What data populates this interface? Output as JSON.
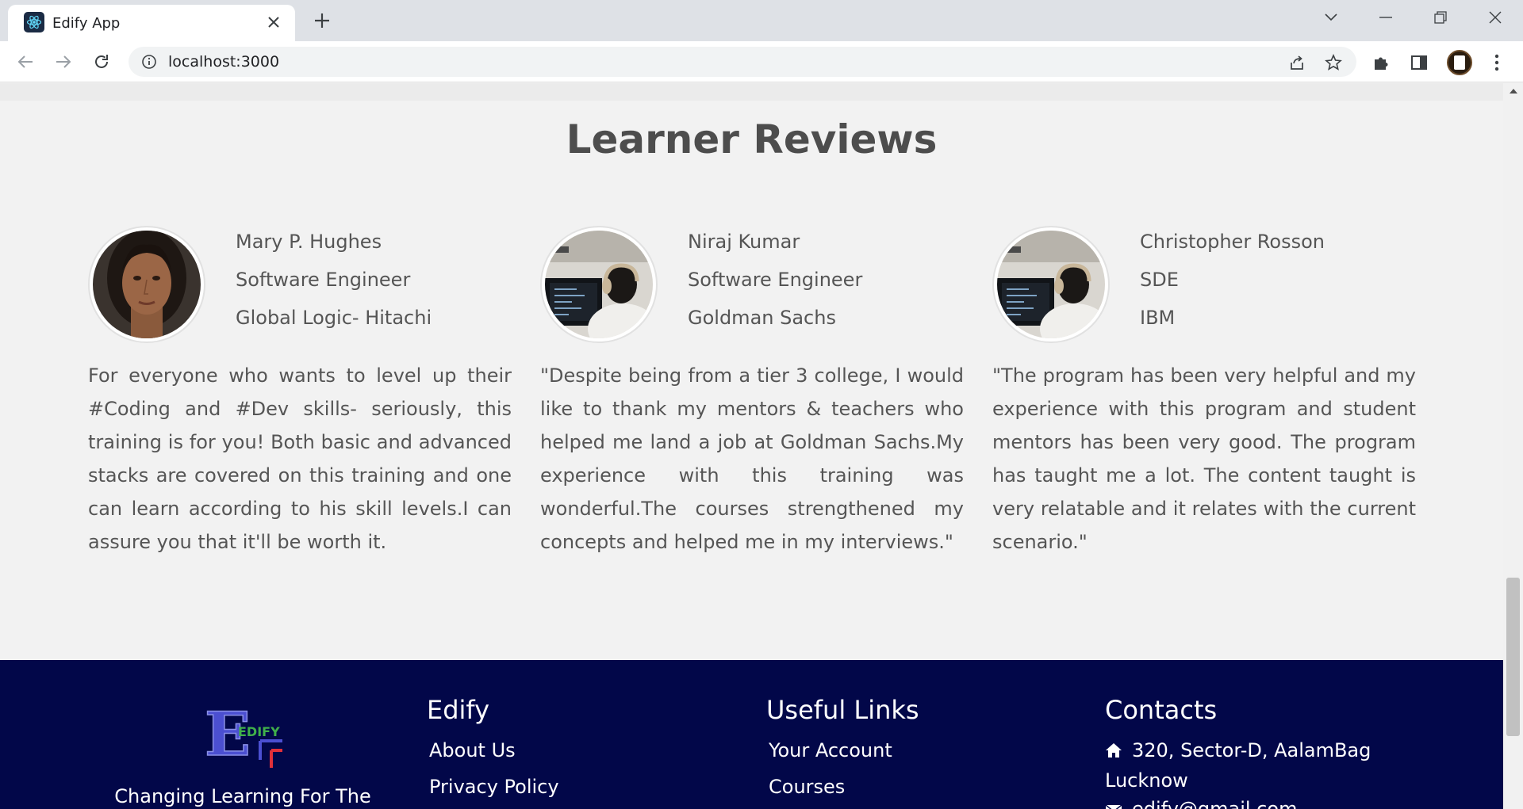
{
  "browser": {
    "tab_title": "Edify App",
    "url": "localhost:3000"
  },
  "reviews": {
    "title": "Learner Reviews",
    "items": [
      {
        "name": "Mary P. Hughes",
        "role": "Software Engineer",
        "company": "Global Logic- Hitachi",
        "text": "For everyone who wants to level up their #Coding and #Dev skills- seriously, this training is for you! Both basic and advanced stacks are covered on this training and one can learn according to his skill levels.I can assure you that it'll be worth it."
      },
      {
        "name": "Niraj Kumar",
        "role": "Software Engineer",
        "company": "Goldman Sachs",
        "text": "\"Despite being from a tier 3 college, I would like to thank my mentors & teachers who helped me land a job at Goldman Sachs.My experience with this training was wonderful.The courses strengthened my concepts and helped me in my interviews.\""
      },
      {
        "name": "Christopher Rosson",
        "role": "SDE",
        "company": "IBM",
        "text": "\"The program has been very helpful and my experience with this program and student mentors has been very good. The program has taught me a lot. The content taught is very relatable and it relates with the current scenario.\""
      }
    ]
  },
  "footer": {
    "logo_text": "EDIFY",
    "tagline": "Changing Learning For The",
    "col_edify": {
      "heading": "Edify",
      "links": [
        "About Us",
        "Privacy Policy"
      ]
    },
    "col_useful": {
      "heading": "Useful Links",
      "links": [
        "Your Account",
        "Courses"
      ]
    },
    "col_contacts": {
      "heading": "Contacts",
      "address": "320, Sector-D, AalamBag Lucknow",
      "email": "edify@gmail.com"
    }
  },
  "colors": {
    "footer_bg": "#020749",
    "page_bg": "#f2f2f2",
    "text": "#555555"
  }
}
